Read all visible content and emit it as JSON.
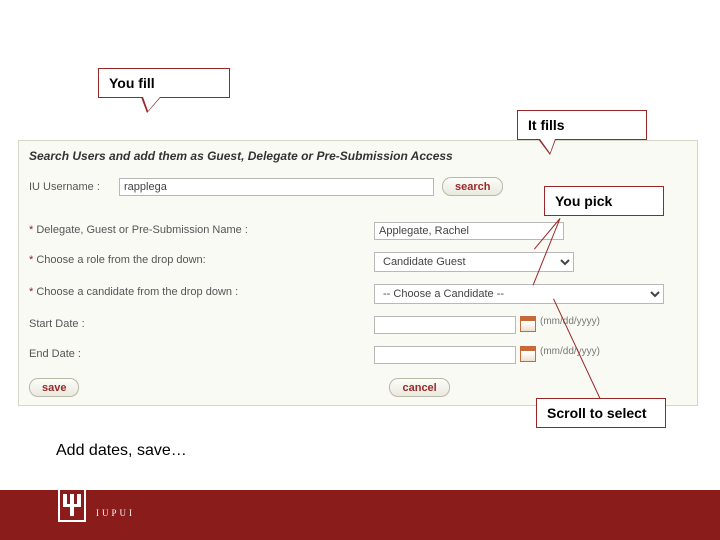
{
  "panel": {
    "heading": "Search Users and add them as Guest, Delegate or Pre-Submission Access",
    "username_label": "IU Username :",
    "username_value": "rapplega",
    "search_label": "search"
  },
  "fields": {
    "name_label": "Delegate, Guest or Pre-Submission Name :",
    "name_value": "Applegate, Rachel",
    "role_label": "Choose a role from the drop down:",
    "role_value": "Candidate Guest",
    "cand_label": "Choose a candidate from the drop down :",
    "cand_value": "-- Choose a Candidate --",
    "start_label": "Start Date :",
    "start_value": "",
    "end_label": "End Date :",
    "end_value": "",
    "date_hint": "(mm/dd/yyyy)"
  },
  "actions": {
    "save": "save",
    "cancel": "cancel"
  },
  "callouts": {
    "you_fill": "You fill",
    "it_fills": "It fills",
    "you_pick": "You pick",
    "scroll": "Scroll to select"
  },
  "caption": "Add dates, save…",
  "footer": {
    "campus": "IUPUI"
  },
  "asterisk": "*"
}
